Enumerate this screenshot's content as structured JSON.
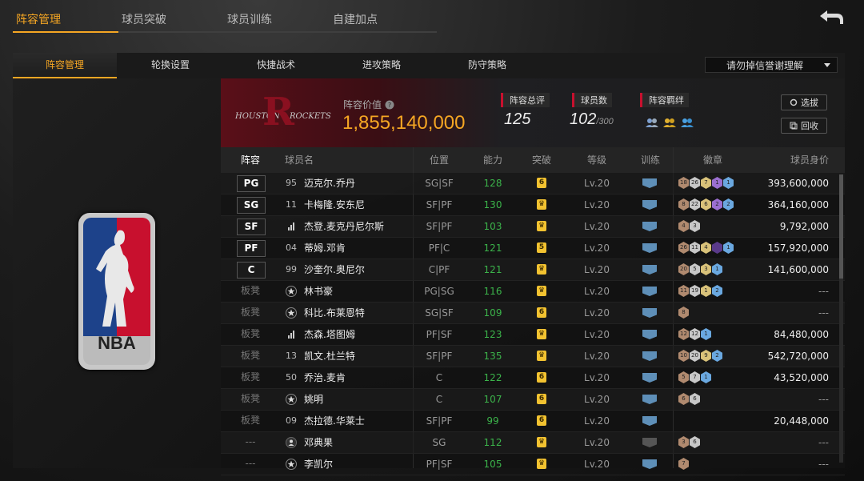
{
  "top_tabs": [
    "阵容管理",
    "球员突破",
    "球员训练",
    "自建加点"
  ],
  "sub_tabs": [
    "阵容管理",
    "轮换设置",
    "快捷战术",
    "进攻策略",
    "防守策略"
  ],
  "dropdown": {
    "selected": "请勿掉信誉谢理解"
  },
  "team": {
    "name_left": "HOUSTON",
    "name_right": "ROCKETS",
    "value_label": "阵容价值",
    "value": "1,855,140,000",
    "overall_label": "阵容总评",
    "overall": "125",
    "players_label": "球员数",
    "players_count": "102",
    "players_max": "/300",
    "bond_label": "阵容羁绊",
    "btn_select": "选拔",
    "btn_recycle": "回收"
  },
  "table": {
    "headers": [
      "阵容",
      "球员名",
      "位置",
      "能力",
      "突破",
      "等级",
      "训练",
      "徽章",
      "球员身价"
    ],
    "rows": [
      {
        "slot": "PG",
        "no": "95",
        "name": "迈克尔.乔丹",
        "pos": "SG|SF",
        "ability": "128",
        "brk": "6",
        "lv": "Lv.20",
        "badges": [
          {
            "n": "18",
            "c": "#b08a6f"
          },
          {
            "n": "26",
            "c": "#c7c7c7"
          },
          {
            "n": "7",
            "c": "#d9c27a"
          },
          {
            "n": "1",
            "c": "#9b6fd0"
          },
          {
            "n": "1",
            "c": "#6aa8e0"
          }
        ],
        "value": "393,600,000",
        "train": "blue"
      },
      {
        "slot": "SG",
        "no": "11",
        "name": "卡梅隆.安东尼",
        "pos": "SF|PF",
        "ability": "130",
        "brk": "♛",
        "lv": "Lv.20",
        "badges": [
          {
            "n": "8",
            "c": "#b08a6f"
          },
          {
            "n": "22",
            "c": "#c7c7c7"
          },
          {
            "n": "6",
            "c": "#d9c27a"
          },
          {
            "n": "2",
            "c": "#9b6fd0"
          },
          {
            "n": "2",
            "c": "#6aa8e0"
          }
        ],
        "value": "364,160,000",
        "train": "blue"
      },
      {
        "slot": "SF",
        "no": "rank",
        "name": "杰登.麦克丹尼尔斯",
        "pos": "SF|PF",
        "ability": "103",
        "brk": "♛",
        "lv": "Lv.20",
        "badges": [
          {
            "n": "4",
            "c": "#b08a6f"
          },
          {
            "n": "3",
            "c": "#c7c7c7"
          }
        ],
        "value": "9,792,000",
        "train": "blue"
      },
      {
        "slot": "PF",
        "no": "04",
        "name": "蒂姆.邓肯",
        "pos": "PF|C",
        "ability": "121",
        "brk": "5",
        "lv": "Lv.20",
        "badges": [
          {
            "n": "26",
            "c": "#b08a6f"
          },
          {
            "n": "11",
            "c": "#c7c7c7"
          },
          {
            "n": "4",
            "c": "#d9c27a"
          },
          {
            "n": "",
            "c": "#5a3a8a"
          },
          {
            "n": "1",
            "c": "#6aa8e0"
          }
        ],
        "value": "157,920,000",
        "train": "blue"
      },
      {
        "slot": "C",
        "no": "99",
        "name": "沙奎尔.奥尼尔",
        "pos": "C|PF",
        "ability": "121",
        "brk": "♛",
        "lv": "Lv.20",
        "badges": [
          {
            "n": "20",
            "c": "#b08a6f"
          },
          {
            "n": "5",
            "c": "#c7c7c7"
          },
          {
            "n": "3",
            "c": "#d9c27a"
          },
          {
            "n": "1",
            "c": "#6aa8e0"
          }
        ],
        "value": "141,600,000",
        "train": "blue"
      },
      {
        "slot": "板凳",
        "no": "star",
        "name": "林书豪",
        "pos": "PG|SG",
        "ability": "116",
        "brk": "♛",
        "lv": "Lv.20",
        "badges": [
          {
            "n": "11",
            "c": "#b08a6f"
          },
          {
            "n": "19",
            "c": "#c7c7c7"
          },
          {
            "n": "1",
            "c": "#d9c27a"
          },
          {
            "n": "2",
            "c": "#6aa8e0"
          }
        ],
        "value": "---",
        "train": "blue"
      },
      {
        "slot": "板凳",
        "no": "star",
        "name": "科比.布莱恩特",
        "pos": "SG|SF",
        "ability": "109",
        "brk": "6",
        "lv": "Lv.20",
        "badges": [
          {
            "n": "8",
            "c": "#b08a6f"
          }
        ],
        "value": "---",
        "train": "blue"
      },
      {
        "slot": "板凳",
        "no": "rank",
        "name": "杰森.塔图姆",
        "pos": "PF|SF",
        "ability": "123",
        "brk": "♛",
        "lv": "Lv.20",
        "badges": [
          {
            "n": "12",
            "c": "#b08a6f"
          },
          {
            "n": "12",
            "c": "#c7c7c7"
          },
          {
            "n": "1",
            "c": "#6aa8e0"
          }
        ],
        "value": "84,480,000",
        "train": "blue"
      },
      {
        "slot": "板凳",
        "no": "13",
        "name": "凯文.杜兰特",
        "pos": "SF|PF",
        "ability": "135",
        "brk": "♛",
        "lv": "Lv.20",
        "badges": [
          {
            "n": "10",
            "c": "#b08a6f"
          },
          {
            "n": "20",
            "c": "#c7c7c7"
          },
          {
            "n": "9",
            "c": "#d9c27a"
          },
          {
            "n": "2",
            "c": "#6aa8e0"
          }
        ],
        "value": "542,720,000",
        "train": "blue"
      },
      {
        "slot": "板凳",
        "no": "50",
        "name": "乔治.麦肯",
        "pos": "C",
        "ability": "122",
        "brk": "6",
        "lv": "Lv.20",
        "badges": [
          {
            "n": "5",
            "c": "#b08a6f"
          },
          {
            "n": "7",
            "c": "#c7c7c7"
          },
          {
            "n": "1",
            "c": "#6aa8e0"
          }
        ],
        "value": "43,520,000",
        "train": "blue"
      },
      {
        "slot": "板凳",
        "no": "star",
        "name": "姚明",
        "pos": "C",
        "ability": "107",
        "brk": "6",
        "lv": "Lv.20",
        "badges": [
          {
            "n": "6",
            "c": "#b08a6f"
          },
          {
            "n": "6",
            "c": "#c7c7c7"
          }
        ],
        "value": "---",
        "train": "blue"
      },
      {
        "slot": "板凳",
        "no": "09",
        "name": "杰拉德.华莱士",
        "pos": "SF|PF",
        "ability": "99",
        "brk": "6",
        "lv": "Lv.20",
        "badges": [],
        "value": "20,448,000",
        "train": "blue"
      },
      {
        "slot": "---",
        "no": "person",
        "name": "邓典果",
        "pos": "SG",
        "ability": "112",
        "brk": "♛",
        "lv": "Lv.20",
        "badges": [
          {
            "n": "3",
            "c": "#b08a6f"
          },
          {
            "n": "6",
            "c": "#c7c7c7"
          }
        ],
        "value": "---",
        "train": "grey"
      },
      {
        "slot": "---",
        "no": "star",
        "name": "李凯尔",
        "pos": "PF|SF",
        "ability": "105",
        "brk": "♛",
        "lv": "Lv.20",
        "badges": [
          {
            "n": "7",
            "c": "#b08a6f"
          }
        ],
        "value": "---",
        "train": "blue"
      }
    ]
  },
  "icons": {
    "back": "back-arrow-icon",
    "help": "question-icon",
    "select": "refresh-icon",
    "recycle": "copy-icon",
    "bond": "team-bond-icon"
  },
  "colors": {
    "accent": "#f5a623",
    "ability": "#3bb34a",
    "train": "#5e8fb8"
  }
}
